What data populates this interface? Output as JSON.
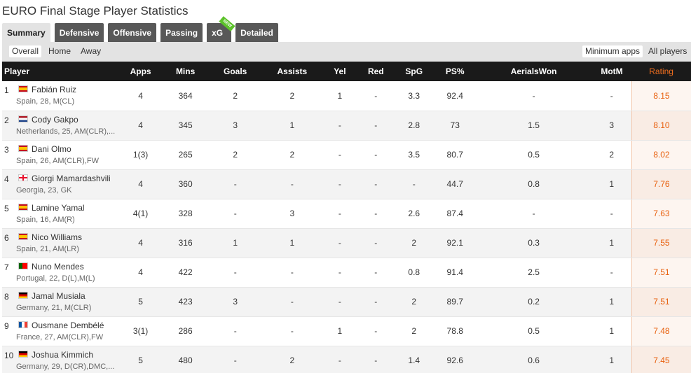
{
  "page_title": "EURO Final Stage Player Statistics",
  "tabs": [
    {
      "label": "Summary",
      "active": true
    },
    {
      "label": "Defensive"
    },
    {
      "label": "Offensive"
    },
    {
      "label": "Passing"
    },
    {
      "label": "xG",
      "badge": "NEW"
    },
    {
      "label": "Detailed"
    }
  ],
  "filters": {
    "overall": "Overall",
    "home": "Home",
    "away": "Away",
    "minimum_apps": "Minimum apps",
    "all_players": "All players"
  },
  "columns": [
    "Player",
    "Apps",
    "Mins",
    "Goals",
    "Assists",
    "Yel",
    "Red",
    "SpG",
    "PS%",
    "AerialsWon",
    "MotM",
    "Rating"
  ],
  "players": [
    {
      "rank": "1",
      "flag": "spain",
      "name": "Fabián Ruiz",
      "meta": "Spain,  28, M(CL)",
      "apps": "4",
      "mins": "364",
      "goals": "2",
      "assists": "2",
      "yel": "1",
      "red": "-",
      "spg": "3.3",
      "ps": "92.4",
      "aerials": "-",
      "motm": "-",
      "rating": "8.15"
    },
    {
      "rank": "2",
      "flag": "netherlands",
      "name": "Cody Gakpo",
      "meta": "Netherlands,  25, AM(CLR),...",
      "apps": "4",
      "mins": "345",
      "goals": "3",
      "assists": "1",
      "yel": "-",
      "red": "-",
      "spg": "2.8",
      "ps": "73",
      "aerials": "1.5",
      "motm": "3",
      "rating": "8.10"
    },
    {
      "rank": "3",
      "flag": "spain",
      "name": "Dani Olmo",
      "meta": "Spain,  26, AM(CLR),FW",
      "apps": "1(3)",
      "mins": "265",
      "goals": "2",
      "assists": "2",
      "yel": "-",
      "red": "-",
      "spg": "3.5",
      "ps": "80.7",
      "aerials": "0.5",
      "motm": "2",
      "rating": "8.02"
    },
    {
      "rank": "4",
      "flag": "georgia",
      "name": "Giorgi Mamardashvili",
      "meta": "Georgia,  23, GK",
      "apps": "4",
      "mins": "360",
      "goals": "-",
      "assists": "-",
      "yel": "-",
      "red": "-",
      "spg": "-",
      "ps": "44.7",
      "aerials": "0.8",
      "motm": "1",
      "rating": "7.76"
    },
    {
      "rank": "5",
      "flag": "spain",
      "name": "Lamine Yamal",
      "meta": "Spain,  16, AM(R)",
      "apps": "4(1)",
      "mins": "328",
      "goals": "-",
      "assists": "3",
      "yel": "-",
      "red": "-",
      "spg": "2.6",
      "ps": "87.4",
      "aerials": "-",
      "motm": "-",
      "rating": "7.63"
    },
    {
      "rank": "6",
      "flag": "spain",
      "name": "Nico Williams",
      "meta": "Spain,  21, AM(LR)",
      "apps": "4",
      "mins": "316",
      "goals": "1",
      "assists": "1",
      "yel": "-",
      "red": "-",
      "spg": "2",
      "ps": "92.1",
      "aerials": "0.3",
      "motm": "1",
      "rating": "7.55"
    },
    {
      "rank": "7",
      "flag": "portugal",
      "name": "Nuno Mendes",
      "meta": "Portugal,  22, D(L),M(L)",
      "apps": "4",
      "mins": "422",
      "goals": "-",
      "assists": "-",
      "yel": "-",
      "red": "-",
      "spg": "0.8",
      "ps": "91.4",
      "aerials": "2.5",
      "motm": "-",
      "rating": "7.51"
    },
    {
      "rank": "8",
      "flag": "germany",
      "name": "Jamal Musiala",
      "meta": "Germany,  21, M(CLR)",
      "apps": "5",
      "mins": "423",
      "goals": "3",
      "assists": "-",
      "yel": "-",
      "red": "-",
      "spg": "2",
      "ps": "89.7",
      "aerials": "0.2",
      "motm": "1",
      "rating": "7.51"
    },
    {
      "rank": "9",
      "flag": "france",
      "name": "Ousmane Dembélé",
      "meta": "France,  27, AM(CLR),FW",
      "apps": "3(1)",
      "mins": "286",
      "goals": "-",
      "assists": "-",
      "yel": "1",
      "red": "-",
      "spg": "2",
      "ps": "78.8",
      "aerials": "0.5",
      "motm": "1",
      "rating": "7.48"
    },
    {
      "rank": "10",
      "flag": "germany",
      "name": "Joshua Kimmich",
      "meta": "Germany,  29, D(CR),DMC,...",
      "apps": "5",
      "mins": "480",
      "goals": "-",
      "assists": "2",
      "yel": "-",
      "red": "-",
      "spg": "1.4",
      "ps": "92.6",
      "aerials": "0.6",
      "motm": "1",
      "rating": "7.45"
    }
  ]
}
